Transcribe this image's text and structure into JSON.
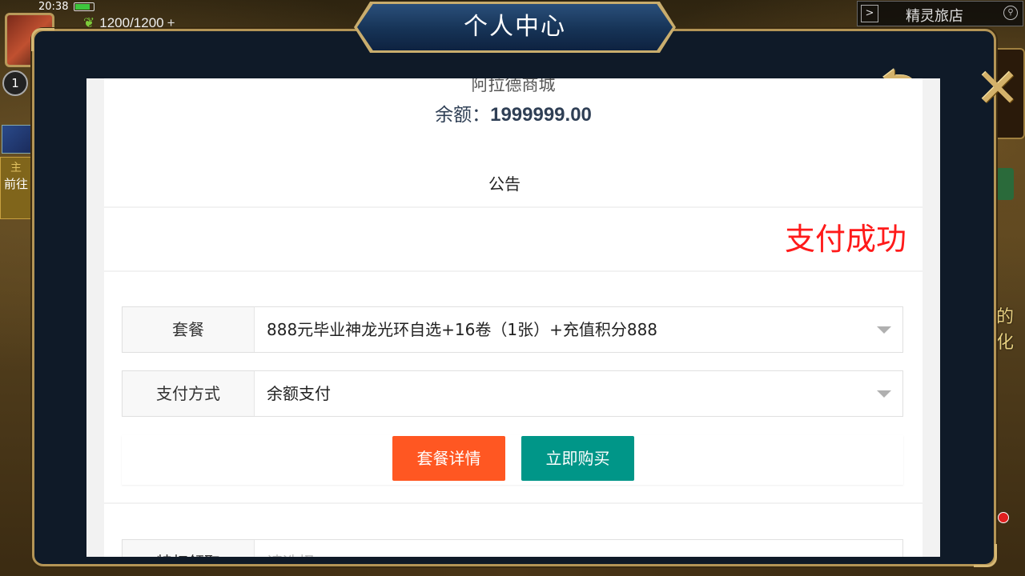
{
  "status": {
    "time": "20:38"
  },
  "hud": {
    "energy": "1200/1200",
    "energy_plus": "+",
    "level": "1",
    "goto_label": "前往",
    "location": "精灵旅店",
    "right_partial_text": "的化"
  },
  "modal": {
    "title": "个人中心",
    "back_symbol": "⮌",
    "close_symbol": "✕"
  },
  "shop": {
    "name": "阿拉德商城",
    "balance_label": "余额：",
    "balance_value": "1999999.00",
    "notice_title": "公告",
    "notice_marquee": "支付成功"
  },
  "form": {
    "package_label": "套餐",
    "package_value": "888元毕业神龙光环自选+16卷（1张）+充值积分888",
    "payment_label": "支付方式",
    "payment_value": "余额支付",
    "detail_button": "套餐详情",
    "buy_button": "立即购买",
    "next_label": "特权领取",
    "next_placeholder": "请选择"
  },
  "colors": {
    "detail_button": "#ff5722",
    "buy_button": "#009688",
    "marquee_text": "#ff1a1a",
    "frame_gold": "#b49556",
    "modal_bg": "#0f1a28"
  }
}
